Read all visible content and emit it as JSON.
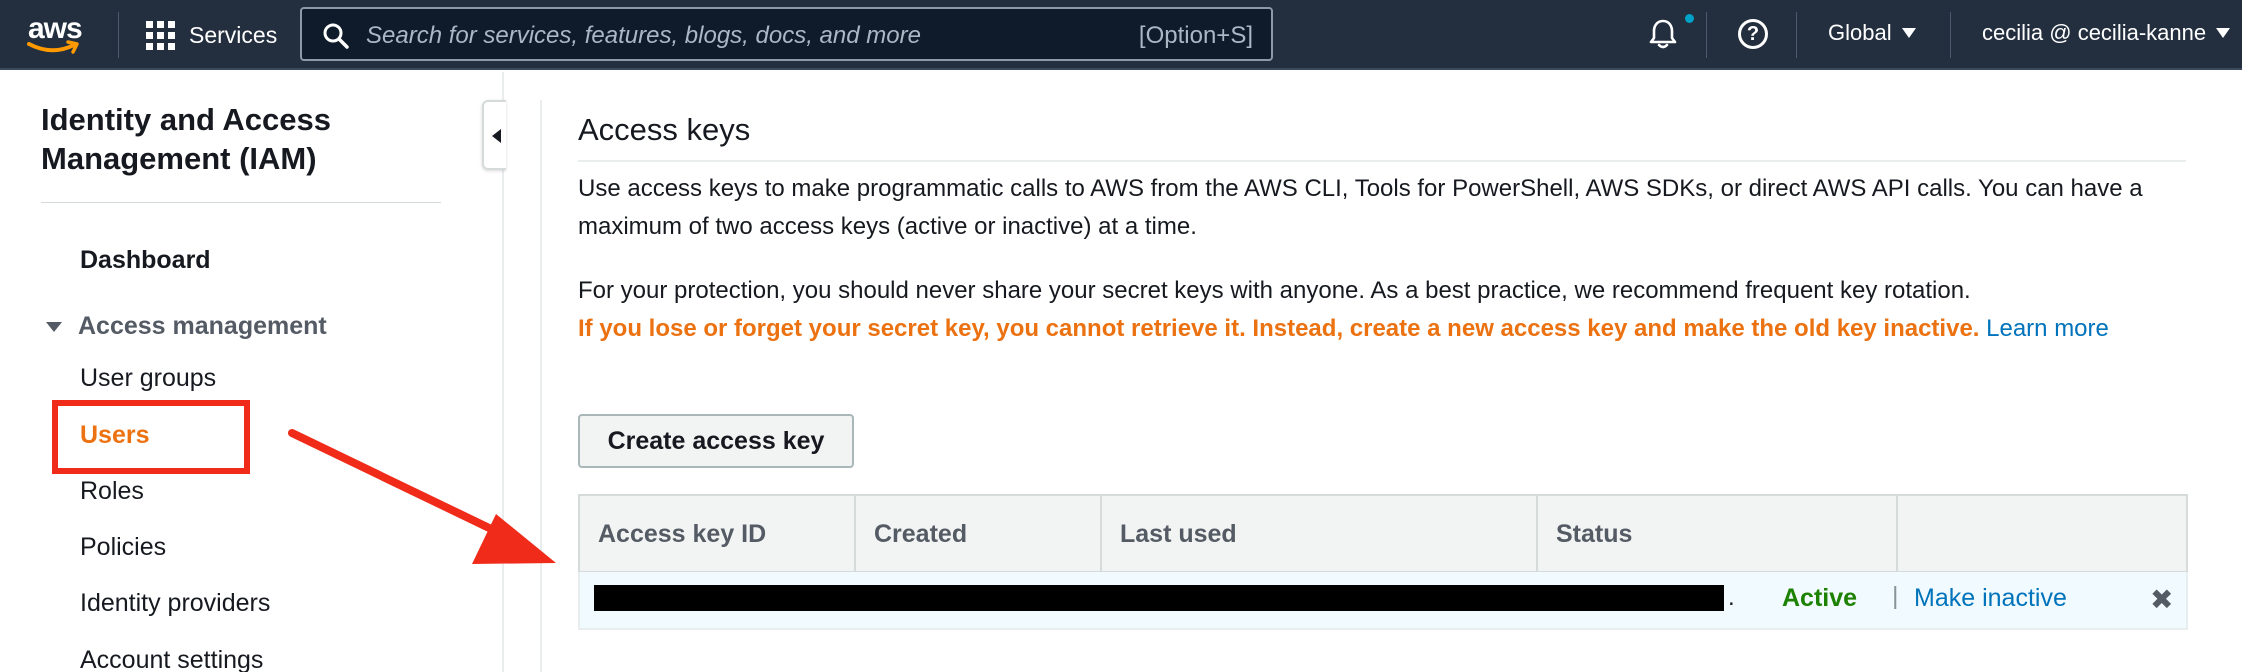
{
  "topnav": {
    "logo_text": "aws",
    "services_label": "Services",
    "search_placeholder": "Search for services, features, blogs, docs, and more",
    "search_shortcut": "[Option+S]",
    "region_label": "Global",
    "account_label": "cecilia @ cecilia-kanne"
  },
  "sidebar": {
    "title": "Identity and Access Management (IAM)",
    "dashboard": "Dashboard",
    "section_label": "Access management",
    "items": [
      "User groups",
      "Users",
      "Roles",
      "Policies",
      "Identity providers",
      "Account settings"
    ],
    "active_item": "Users"
  },
  "main": {
    "title": "Access keys",
    "paragraph1": "Use access keys to make programmatic calls to AWS from the AWS CLI, Tools for PowerShell, AWS SDKs, or direct AWS API calls. You can have a maximum of two access keys (active or inactive) at a time.",
    "paragraph2": "For your protection, you should never share your secret keys with anyone. As a best practice, we recommend frequent key rotation.",
    "warning": "If you lose or forget your secret key, you cannot retrieve it. Instead, create a new access key and make the old key inactive.",
    "learn_more": "Learn more",
    "create_button": "Create access key",
    "table": {
      "headers": [
        "Access key ID",
        "Created",
        "Last used",
        "Status"
      ],
      "row": {
        "key_suffix": ".",
        "status": "Active",
        "action": "Make inactive",
        "delete_glyph": "✖"
      }
    }
  },
  "colors": {
    "nav_bg": "#232f3e",
    "accent_orange": "#ec7211",
    "link_blue": "#0073bb",
    "status_green": "#1d8102",
    "annotation_red": "#f02b1a"
  }
}
